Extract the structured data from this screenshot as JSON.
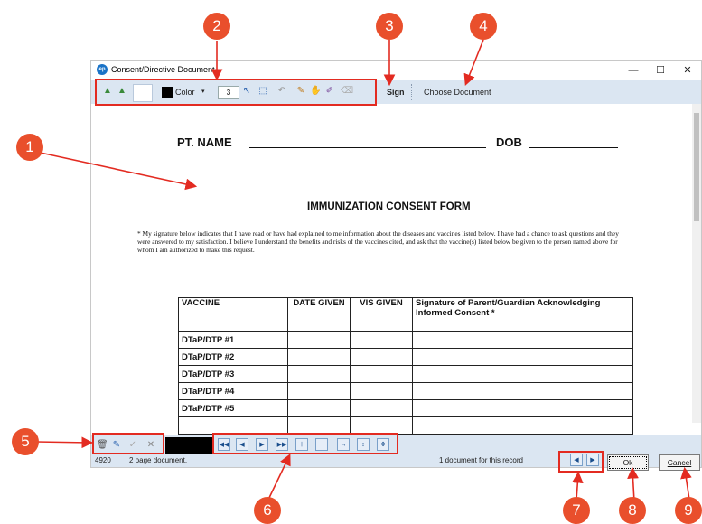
{
  "window": {
    "title": "Consent/Directive Document",
    "app_icon_text": "ep",
    "controls": {
      "minimize": "—",
      "maximize": "☐",
      "close": "✕"
    }
  },
  "toolbar": {
    "color_label": "Color",
    "stroke_width": "3",
    "sign_label": "Sign",
    "choose_document_label": "Choose Document"
  },
  "document": {
    "pt_name_label": "PT. NAME",
    "dob_label": "DOB",
    "form_title": "IMMUNIZATION CONSENT FORM",
    "consent_text": "* My signature below indicates that I have read or have had explained to me information about the diseases and vaccines listed below. I have had a chance to ask questions and they were answered to my satisfaction. I believe I understand the benefits and risks of the vaccines cited, and ask that the vaccine(s) listed below be given to the person named above for whom I am authorized to make this request.",
    "table": {
      "headers": [
        "VACCINE",
        "DATE GIVEN",
        "VIS GIVEN",
        "Signature of Parent/Guardian Acknowledging Informed Consent *"
      ],
      "rows": [
        "DTaP/DTP #1",
        "DTaP/DTP #2",
        "DTaP/DTP #3",
        "DTaP/DTP #4",
        "DTaP/DTP #5",
        ""
      ]
    }
  },
  "status": {
    "id": "4920",
    "pages": "2 page document.",
    "record_docs": "1 document for this record"
  },
  "buttons": {
    "ok": "Ok",
    "cancel": "Cancel"
  },
  "callouts": [
    "1",
    "2",
    "3",
    "4",
    "5",
    "6",
    "7",
    "8",
    "9"
  ],
  "colors": {
    "callout": "#e94f2c",
    "highlight_box": "#e32b21",
    "toolbar_bg": "#dbe6f2"
  },
  "icons": {
    "toolbar_left": [
      "mountain-icon",
      "mountain-icon",
      "blank-swatch"
    ],
    "toolbar_tools": [
      "pointer-icon",
      "select-rect-icon",
      "undo-icon",
      "pen-icon",
      "hand-icon",
      "brush-icon",
      "eraser-icon"
    ],
    "bottom_left": [
      "trash-icon",
      "pencil-icon",
      "check-icon",
      "x-icon"
    ],
    "nav_tools": [
      "first-page-icon",
      "prev-page-icon",
      "next-page-icon",
      "last-page-icon",
      "zoom-in-icon",
      "zoom-out-icon",
      "fit-width-icon",
      "fit-height-icon",
      "fit-all-icon"
    ]
  }
}
